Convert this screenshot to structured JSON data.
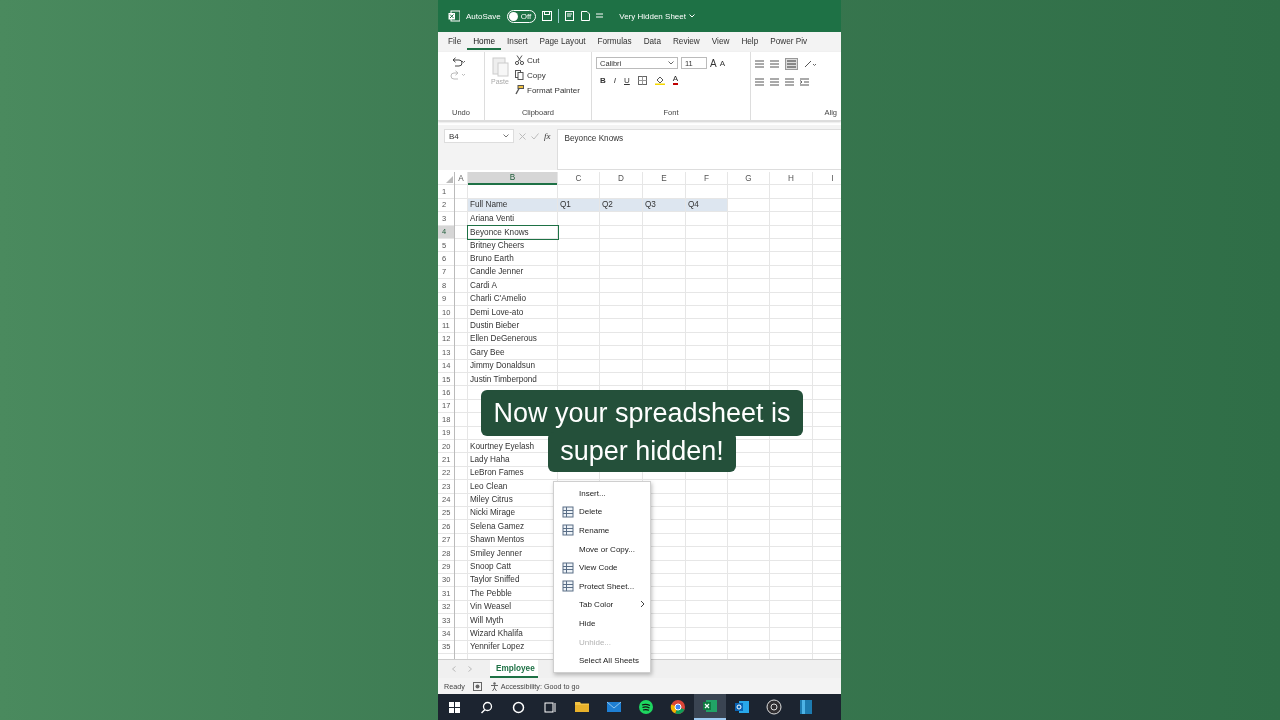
{
  "title_bar": {
    "autosave_label": "AutoSave",
    "autosave": {
      "on": false,
      "label": "Off"
    },
    "title": "Very Hidden Sheet"
  },
  "ribbon_tabs": [
    {
      "label": "File",
      "selected": false
    },
    {
      "label": "Home",
      "selected": true
    },
    {
      "label": "Insert",
      "selected": false
    },
    {
      "label": "Page Layout",
      "selected": false
    },
    {
      "label": "Formulas",
      "selected": false
    },
    {
      "label": "Data",
      "selected": false
    },
    {
      "label": "Review",
      "selected": false
    },
    {
      "label": "View",
      "selected": false
    },
    {
      "label": "Help",
      "selected": false
    },
    {
      "label": "Power Piv",
      "selected": false
    }
  ],
  "ribbon": {
    "undo_label": "Undo",
    "clipboard": {
      "label": "Clipboard",
      "paste": "Paste",
      "cut": "Cut",
      "copy": "Copy",
      "format_painter": "Format Painter"
    },
    "font": {
      "label": "Font",
      "name": "Calibri",
      "size": "11",
      "grow": "A",
      "shrink": "A",
      "styles": [
        "B",
        "I",
        "U"
      ],
      "color_glyph": "A"
    },
    "alignment_label": "Alig"
  },
  "formula_bar": {
    "name_box": "B4",
    "function_label": "fx",
    "content": "Beyonce Knows"
  },
  "grid": {
    "columns": [
      {
        "label": "A",
        "selected": false
      },
      {
        "label": "B",
        "selected": true
      },
      {
        "label": "C",
        "selected": false
      },
      {
        "label": "D",
        "selected": false
      },
      {
        "label": "E",
        "selected": false
      },
      {
        "label": "F",
        "selected": false
      },
      {
        "label": "G",
        "selected": false
      },
      {
        "label": "H",
        "selected": false
      },
      {
        "label": "I",
        "selected": false
      }
    ],
    "rows": [
      {
        "number": "1",
        "kind": "data",
        "selected": false
      },
      {
        "number": "2",
        "kind": "header",
        "selected": false,
        "name": "Full Name",
        "quarters": [
          "Q1",
          "Q2",
          "Q3",
          "Q4"
        ]
      },
      {
        "number": "3",
        "kind": "data",
        "selected": false,
        "name": "Ariana Venti"
      },
      {
        "number": "4",
        "kind": "data",
        "selected": true,
        "name": "Beyonce Knows"
      },
      {
        "number": "5",
        "kind": "data",
        "selected": false,
        "name": "Britney Cheers"
      },
      {
        "number": "6",
        "kind": "data",
        "selected": false,
        "name": "Bruno Earth"
      },
      {
        "number": "7",
        "kind": "data",
        "selected": false,
        "name": "Candle Jenner"
      },
      {
        "number": "8",
        "kind": "data",
        "selected": false,
        "name": "Cardi A"
      },
      {
        "number": "9",
        "kind": "data",
        "selected": false,
        "name": "Charli C'Amelio"
      },
      {
        "number": "10",
        "kind": "data",
        "selected": false,
        "name": "Demi Love-ato"
      },
      {
        "number": "11",
        "kind": "data",
        "selected": false,
        "name": "Dustin Bieber"
      },
      {
        "number": "12",
        "kind": "data",
        "selected": false,
        "name": "Ellen DeGenerous"
      },
      {
        "number": "13",
        "kind": "data",
        "selected": false,
        "name": "Gary Bee"
      },
      {
        "number": "14",
        "kind": "data",
        "selected": false,
        "name": "Jimmy Donaldsun"
      },
      {
        "number": "15",
        "kind": "data",
        "selected": false,
        "name": "Justin Timberpond"
      },
      {
        "number": "16",
        "kind": "data",
        "selected": false
      },
      {
        "number": "17",
        "kind": "data",
        "selected": false
      },
      {
        "number": "18",
        "kind": "data",
        "selected": false
      },
      {
        "number": "19",
        "kind": "data",
        "selected": false
      },
      {
        "number": "20",
        "kind": "data",
        "selected": false,
        "name": "Kourtney Eyelash"
      },
      {
        "number": "21",
        "kind": "data",
        "selected": false,
        "name": "Lady Haha"
      },
      {
        "number": "22",
        "kind": "data",
        "selected": false,
        "name": "LeBron Fames"
      },
      {
        "number": "23",
        "kind": "data",
        "selected": false,
        "name": "Leo Clean"
      },
      {
        "number": "24",
        "kind": "data",
        "selected": false,
        "name": "Miley Citrus"
      },
      {
        "number": "25",
        "kind": "data",
        "selected": false,
        "name": "Nicki Mirage"
      },
      {
        "number": "26",
        "kind": "data",
        "selected": false,
        "name": "Selena Gamez"
      },
      {
        "number": "27",
        "kind": "data",
        "selected": false,
        "name": "Shawn Mentos"
      },
      {
        "number": "28",
        "kind": "data",
        "selected": false,
        "name": "Smiley Jenner"
      },
      {
        "number": "29",
        "kind": "data",
        "selected": false,
        "name": "Snoop Catt"
      },
      {
        "number": "30",
        "kind": "data",
        "selected": false,
        "name": "Taylor Sniffed"
      },
      {
        "number": "31",
        "kind": "data",
        "selected": false,
        "name": "The Pebble"
      },
      {
        "number": "32",
        "kind": "data",
        "selected": false,
        "name": "Vin Weasel"
      },
      {
        "number": "33",
        "kind": "data",
        "selected": false,
        "name": "Will Myth"
      },
      {
        "number": "34",
        "kind": "data",
        "selected": false,
        "name": "Wizard Khalifa"
      },
      {
        "number": "35",
        "kind": "data",
        "selected": false,
        "name": "Yennifer Lopez"
      }
    ]
  },
  "caption": [
    "Now your spreadsheet is",
    "super hidden!"
  ],
  "context_menu": [
    {
      "label": "Insert...",
      "kind": "plain",
      "disabled": false,
      "submenu": false
    },
    {
      "label": "Delete",
      "kind": "icon",
      "disabled": false,
      "submenu": false
    },
    {
      "label": "Rename",
      "kind": "icon",
      "disabled": false,
      "submenu": false
    },
    {
      "label": "Move or Copy...",
      "kind": "plain",
      "disabled": false,
      "submenu": false
    },
    {
      "label": "View Code",
      "kind": "icon",
      "disabled": false,
      "submenu": false
    },
    {
      "label": "Protect Sheet...",
      "kind": "icon",
      "disabled": false,
      "submenu": false
    },
    {
      "label": "Tab Color",
      "kind": "plain",
      "disabled": false,
      "submenu": true
    },
    {
      "label": "Hide",
      "kind": "plain",
      "disabled": false,
      "submenu": false
    },
    {
      "label": "Unhide...",
      "kind": "plain",
      "disabled": true,
      "submenu": false
    },
    {
      "label": "Select All Sheets",
      "kind": "plain",
      "disabled": false,
      "submenu": false
    }
  ],
  "sheet_tabs": [
    {
      "label": "Employee",
      "selected": true
    }
  ],
  "status_bar": {
    "ready": "Ready",
    "accessibility": "Accessibility: Good to go"
  },
  "taskbar": {
    "apps": [
      {
        "selected": false
      },
      {
        "selected": false
      },
      {
        "selected": false
      },
      {
        "selected": false
      },
      {
        "selected": true
      },
      {
        "selected": false
      },
      {
        "selected": false
      },
      {
        "selected": false
      }
    ]
  }
}
